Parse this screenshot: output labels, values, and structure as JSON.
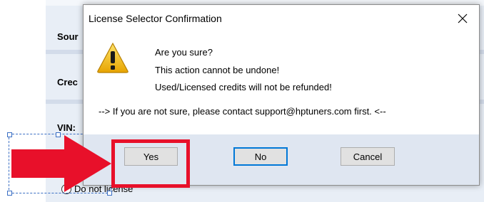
{
  "background_app": {
    "labels": [
      "Sour",
      "Crec",
      "VIN:"
    ],
    "radio_label": "Do not license"
  },
  "dialog": {
    "title": "License Selector Confirmation",
    "messages": [
      "Are you sure?",
      "This action cannot be undone!",
      "Used/Licensed credits will not be refunded!"
    ],
    "hint": "--> If you are not sure, please contact support@hptuners.com first. <--",
    "buttons": {
      "yes": "Yes",
      "no": "No",
      "cancel": "Cancel"
    },
    "icon": "warning-icon"
  },
  "annotation": {
    "color": "#e8102a"
  }
}
